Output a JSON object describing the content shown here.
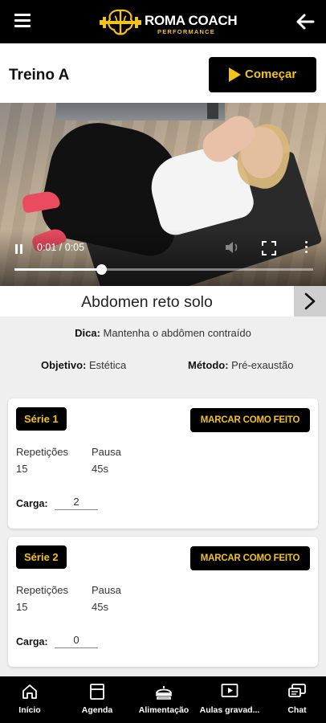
{
  "topbar": {
    "logo_title": "ROMA COACH",
    "logo_subtitle": "PERFORMANCE",
    "menu_icon": "hamburger-menu-icon",
    "back_icon": "arrow-left-icon"
  },
  "header": {
    "title": "Treino A",
    "start_label": "Começar"
  },
  "video": {
    "time": "0:01 / 0:05",
    "progress": 0.29
  },
  "exercise": {
    "name": "Abdomen reto solo",
    "tip_label": "Dica:",
    "tip_value": " Mantenha o abdômen contraído",
    "objective_label": "Objetivo:",
    "objective_value": " Estética",
    "method_label": "Método:",
    "method_value": " Pré-exaustão"
  },
  "series": [
    {
      "label": "Série 1",
      "done_label": "MARCAR COMO FEITO",
      "reps_label": "Repetições",
      "reps_value": "15",
      "rest_label": "Pausa",
      "rest_value": "45s",
      "load_label": "Carga:",
      "load_value": "2"
    },
    {
      "label": "Série 2",
      "done_label": "MARCAR COMO FEITO",
      "reps_label": "Repetições",
      "reps_value": "15",
      "rest_label": "Pausa",
      "rest_value": "45s",
      "load_label": "Carga:",
      "load_value": "0"
    }
  ],
  "bottom_nav": [
    {
      "label": "Início",
      "icon": "home-icon"
    },
    {
      "label": "Agenda",
      "icon": "agenda-icon"
    },
    {
      "label": "Alimentação",
      "icon": "food-icon"
    },
    {
      "label": "Aulas gravad...",
      "icon": "video-play-icon"
    },
    {
      "label": "Chat",
      "icon": "chat-icon"
    }
  ],
  "colors": {
    "accent": "#f2c318",
    "bar_background": "#000000",
    "page_background": "#efefef"
  }
}
